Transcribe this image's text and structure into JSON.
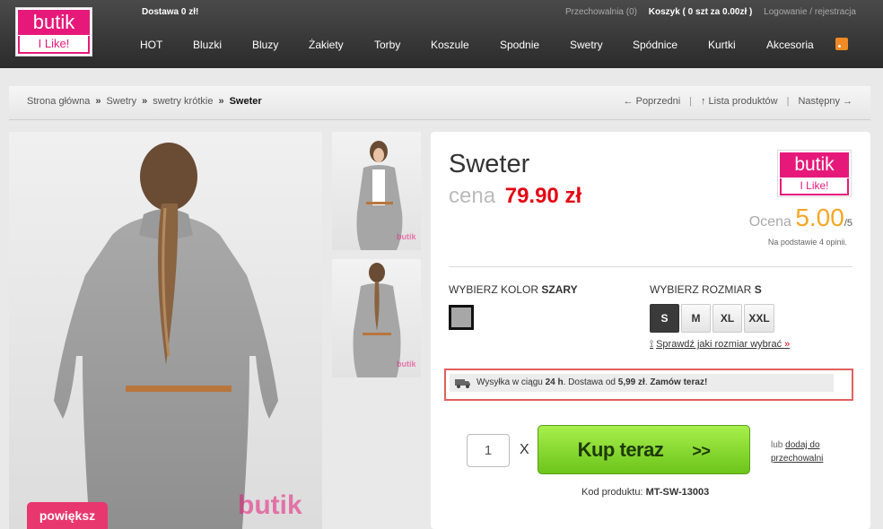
{
  "header": {
    "logo_top": "butik",
    "logo_bottom": "I Like!",
    "delivery": "Dostawa 0 zł!",
    "wishlist": "Przechowalnia (0)",
    "cart": "Koszyk ( 0 szt za 0.00zł )",
    "login": "Logowanie / rejestracja"
  },
  "nav": [
    "HOT",
    "Bluzki",
    "Bluzy",
    "Żakiety",
    "Torby",
    "Koszule",
    "Spodnie",
    "Swetry",
    "Spódnice",
    "Kurtki",
    "Akcesoria"
  ],
  "breadcrumb": {
    "items": [
      "Strona główna",
      "Swetry",
      "swetry krótkie"
    ],
    "current": "Sweter",
    "separator": "»"
  },
  "product_nav": {
    "prev": "← Poprzedni",
    "list": "↑ Lista produktów",
    "next": "Następny →"
  },
  "gallery": {
    "zoom_label": "powiększ",
    "watermark": "butik"
  },
  "product": {
    "title": "Sweter",
    "price_label": "cena",
    "price": "79.90 zł",
    "rating_label": "Ocena",
    "rating_score": "5.00",
    "rating_max": "/5",
    "rating_note_pre": "Na podstawie",
    "rating_note_count": "4",
    "rating_note_post": "opinii.",
    "color_label": "WYBIERZ KOLOR",
    "color_value": "SZARY",
    "color_hex": "#a7a7a7",
    "size_label": "WYBIERZ ROZMIAR",
    "size_value": "S",
    "sizes": [
      "S",
      "M",
      "XL",
      "XXL"
    ],
    "size_guide": "Sprawdź jaki rozmiar wybrać",
    "size_guide_arrow": "»",
    "shipping_pre": "Wysyłka w ciągu",
    "shipping_time": "24 h",
    "shipping_mid": ". Dostawa od",
    "shipping_price": "5,99 zł",
    "shipping_cta": "Zamów teraz!",
    "quantity": "1",
    "times": "X",
    "buy_label": "Kup teraz",
    "buy_chev": ">>",
    "or_label": "lub",
    "add_wishlist_1": "dodaj do",
    "add_wishlist_2": "przechowalni",
    "code_label": "Kod produktu:",
    "code_value": "MT-SW-13003"
  },
  "colors": {
    "brand_pink": "#e6197a",
    "price_red": "#e30613",
    "buy_green": "#8fd935",
    "rating_orange": "#f5a623"
  }
}
